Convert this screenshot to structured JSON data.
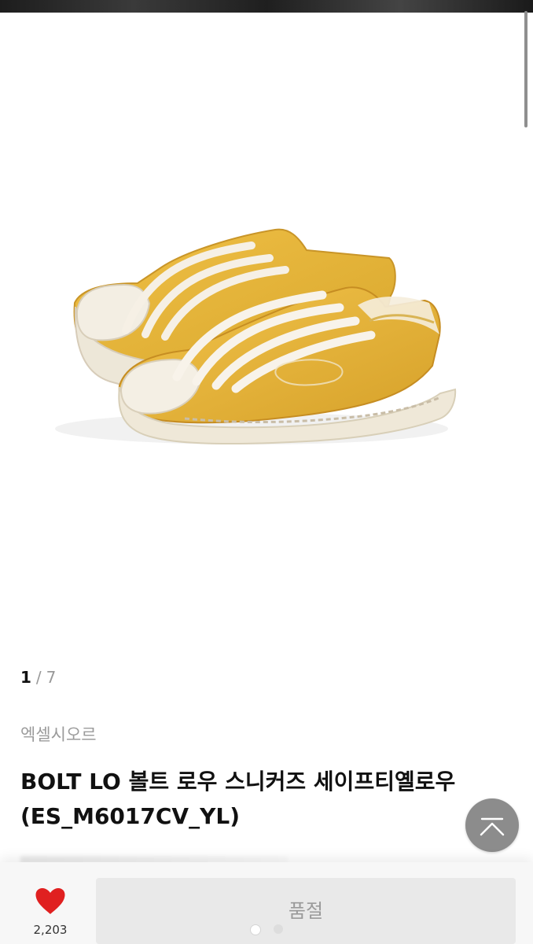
{
  "gallery": {
    "current": "1",
    "separator": "/",
    "total": "7"
  },
  "product": {
    "brand": "엑셀시오르",
    "title_line1": "BOLT LO 볼트 로우 스니커즈 세이프티옐로우",
    "title_line2": "(ES_M6017CV_YL)"
  },
  "actions": {
    "like_count": "2,203",
    "soldout_label": "품절"
  },
  "icons": {
    "like": "heart-icon",
    "scroll_top": "chevron-up-icon"
  },
  "colors": {
    "heart": "#e02020",
    "shoe_yellow": "#e5b43a",
    "sole_cream": "#efe8d8"
  }
}
